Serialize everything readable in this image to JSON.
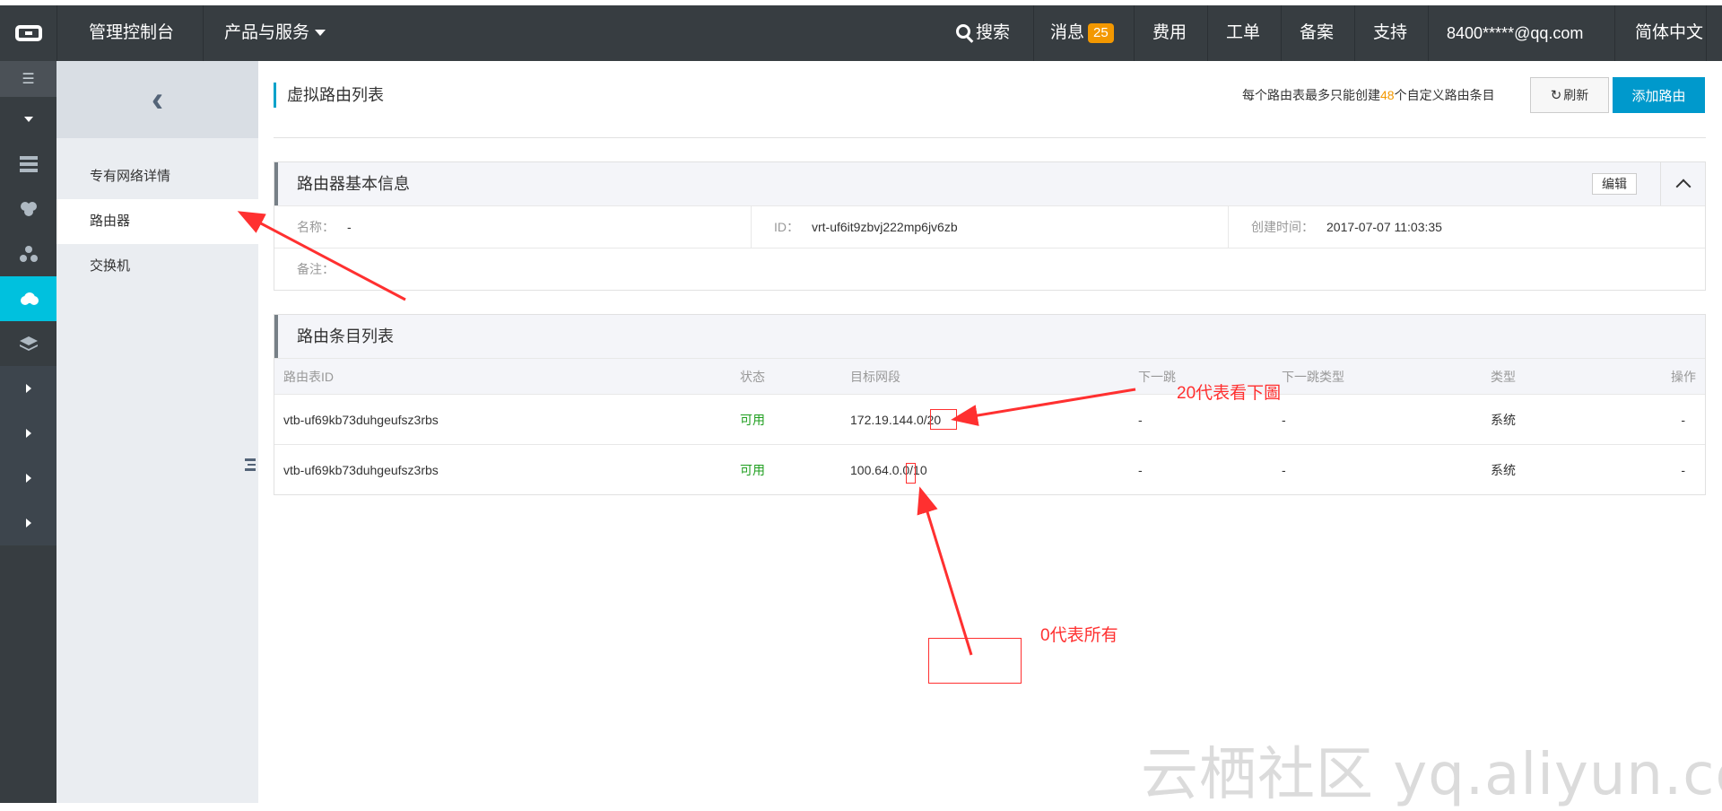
{
  "topbar": {
    "console_label": "管理控制台",
    "products_label": "产品与服务",
    "search_label": "搜索",
    "messages_label": "消息",
    "messages_count": "25",
    "billing_label": "费用",
    "tickets_label": "工单",
    "icp_label": "备案",
    "support_label": "支持",
    "account": "8400*****@qq.com",
    "language": "简体中文"
  },
  "subnav": {
    "items": [
      {
        "label": "专有网络详情"
      },
      {
        "label": "路由器"
      },
      {
        "label": "交换机"
      }
    ]
  },
  "page": {
    "title": "虚拟路由列表",
    "limit_prefix": "每个路由表最多只能创建",
    "limit_number": "48",
    "limit_suffix": "个自定义路由条目",
    "refresh_label": "刷新",
    "add_route_label": "添加路由"
  },
  "router_info": {
    "heading": "路由器基本信息",
    "edit_label": "编辑",
    "name_label": "名称：",
    "name_value": "-",
    "id_label": "ID：",
    "id_value": "vrt-uf6it9zbvj222mp6jv6zb",
    "created_label": "创建时间：",
    "created_value": "2017-07-07 11:03:35",
    "note_label": "备注："
  },
  "route_table": {
    "heading": "路由条目列表",
    "columns": [
      "路由表ID",
      "状态",
      "目标网段",
      "下一跳",
      "下一跳类型",
      "类型",
      "操作"
    ],
    "rows": [
      {
        "table_id": "vtb-uf69kb73duhgeufsz3rbs",
        "status": "可用",
        "cidr": "172.19.144.0/20",
        "next_hop": "-",
        "next_hop_type": "-",
        "type": "系统",
        "action": "-"
      },
      {
        "table_id": "vtb-uf69kb73duhgeufsz3rbs",
        "status": "可用",
        "cidr": "100.64.0.0/10",
        "next_hop": "-",
        "next_hop_type": "-",
        "type": "系统",
        "action": "-"
      }
    ]
  },
  "annotations": {
    "note_20": "20代表看下圖",
    "note_0": "0代表所有"
  },
  "watermark": "云栖社区 yq.aliyun.com",
  "colors": {
    "accent": "#00c1de",
    "primary_button": "#0099cc",
    "annotation": "#ff3030",
    "available": "#1e9e1e",
    "highlight_number": "#f39800"
  }
}
